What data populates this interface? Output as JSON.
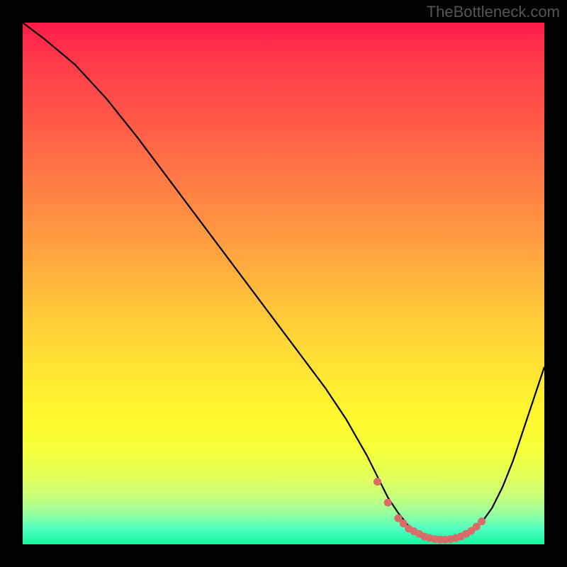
{
  "watermark": "TheBottleneck.com",
  "chart_data": {
    "type": "line",
    "title": "",
    "xlabel": "",
    "ylabel": "",
    "xlim": [
      0,
      100
    ],
    "ylim": [
      0,
      100
    ],
    "series": [
      {
        "name": "curve",
        "x": [
          0,
          4,
          10,
          16,
          22,
          28,
          34,
          40,
          46,
          52,
          58,
          62,
          66,
          68,
          70,
          72,
          74,
          76,
          78,
          80,
          82,
          84,
          86,
          88,
          90,
          92,
          94,
          96,
          98,
          100
        ],
        "y": [
          100,
          97,
          92,
          85.5,
          78,
          70,
          62,
          54,
          46,
          38,
          30,
          24,
          17,
          13,
          9,
          6,
          3.5,
          2,
          1.2,
          0.8,
          0.8,
          1.2,
          2.3,
          4.2,
          7,
          11,
          16,
          22,
          28,
          34
        ]
      }
    ],
    "markers": {
      "name": "highlight-dots",
      "color": "#d96b6b",
      "x": [
        68,
        70,
        72,
        73,
        74,
        75,
        76,
        77,
        78,
        79,
        80,
        81,
        82,
        83,
        84,
        85,
        86,
        87,
        88
      ],
      "y": [
        12,
        8,
        5,
        4,
        3,
        2.5,
        2,
        1.5,
        1.2,
        1,
        0.9,
        0.9,
        1,
        1.2,
        1.5,
        2,
        2.6,
        3.4,
        4.4
      ]
    },
    "background": {
      "type": "vertical-gradient",
      "stops": [
        {
          "pos": 0,
          "color": "#ff1a4a"
        },
        {
          "pos": 50,
          "color": "#ffb03d"
        },
        {
          "pos": 80,
          "color": "#fff92e"
        },
        {
          "pos": 100,
          "color": "#14f5a0"
        }
      ]
    }
  }
}
